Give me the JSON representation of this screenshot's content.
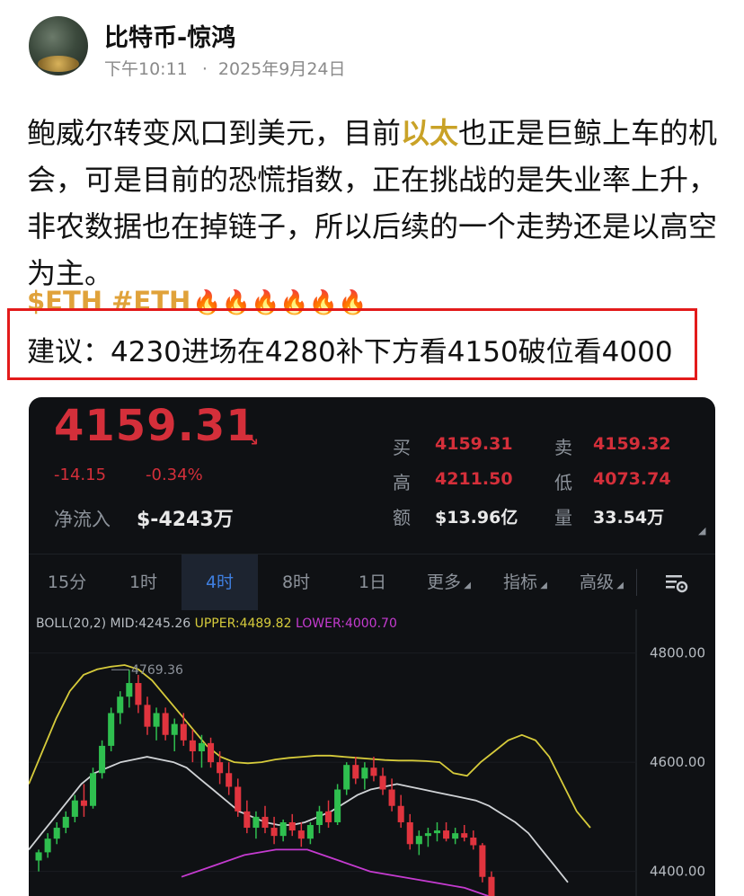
{
  "post": {
    "author": "比特币-惊鸿",
    "time": "下午10:11",
    "dot": "·",
    "date": "2025年9月24日",
    "body_before": "鲍威尔转变风口到美元，目前",
    "body_highlight": "以太",
    "body_after": "也正是巨鲸上车的机会，可是目前的恐慌指数，正在挑战的是失业率上升，非农数据也在掉链子，所以后续的一个走势还是以高空为主。",
    "tags": "$ETH #ETH",
    "fires": "🔥🔥🔥🔥🔥🔥",
    "advice": "建议：4230进场在4280补下方看4150破位看4000"
  },
  "quote": {
    "price": "4159.31",
    "arrow": "↘",
    "change": "-14.15",
    "change_pct": "-0.34%",
    "inflow_label": "净流入",
    "inflow_value": "$-4243万",
    "buy_label": "买",
    "buy": "4159.31",
    "sell_label": "卖",
    "sell": "4159.32",
    "high_label": "高",
    "high": "4211.50",
    "low_label": "低",
    "low": "4073.74",
    "amount_label": "额",
    "amount": "$13.96亿",
    "volume_label": "量",
    "volume": "33.54万"
  },
  "tabs": [
    "15分",
    "1时",
    "4时",
    "8时",
    "1日",
    "更多",
    "指标",
    "高级"
  ],
  "active_tab": "4时",
  "indicator": {
    "name": "BOLL(20,2)",
    "mid": "MID:4245.26",
    "upper": "UPPER:4489.82",
    "lower": "LOWER:4000.70"
  },
  "colors": {
    "up": "#2fbf4f",
    "down": "#e0343e",
    "upper": "#d6cb3b",
    "mid": "#d0d3d6",
    "lower": "#c53bd0",
    "accent": "#3f7fe0"
  },
  "chart_data": {
    "type": "candlestick",
    "y_ticks": [
      "4800.00",
      "4600.00",
      "4400.00"
    ],
    "ylim": [
      4355,
      4880
    ],
    "annotation": "4769.36",
    "candles": [
      [
        4420,
        4440,
        4400,
        4435
      ],
      [
        4435,
        4470,
        4425,
        4460
      ],
      [
        4460,
        4490,
        4450,
        4480
      ],
      [
        4480,
        4510,
        4470,
        4500
      ],
      [
        4500,
        4540,
        4490,
        4530
      ],
      [
        4530,
        4560,
        4500,
        4520
      ],
      [
        4520,
        4590,
        4515,
        4580
      ],
      [
        4580,
        4640,
        4570,
        4630
      ],
      [
        4630,
        4700,
        4620,
        4690
      ],
      [
        4690,
        4730,
        4670,
        4720
      ],
      [
        4720,
        4769,
        4700,
        4745
      ],
      [
        4745,
        4760,
        4690,
        4705
      ],
      [
        4705,
        4720,
        4650,
        4665
      ],
      [
        4665,
        4700,
        4640,
        4690
      ],
      [
        4690,
        4700,
        4640,
        4650
      ],
      [
        4650,
        4680,
        4620,
        4670
      ],
      [
        4670,
        4690,
        4630,
        4640
      ],
      [
        4640,
        4660,
        4600,
        4620
      ],
      [
        4620,
        4650,
        4590,
        4635
      ],
      [
        4635,
        4645,
        4590,
        4600
      ],
      [
        4600,
        4620,
        4560,
        4580
      ],
      [
        4580,
        4600,
        4540,
        4555
      ],
      [
        4555,
        4570,
        4500,
        4510
      ],
      [
        4510,
        4530,
        4470,
        4480
      ],
      [
        4480,
        4510,
        4460,
        4500
      ],
      [
        4500,
        4520,
        4470,
        4480
      ],
      [
        4480,
        4500,
        4450,
        4465
      ],
      [
        4465,
        4495,
        4455,
        4490
      ],
      [
        4490,
        4505,
        4465,
        4475
      ],
      [
        4475,
        4490,
        4445,
        4460
      ],
      [
        4460,
        4490,
        4450,
        4485
      ],
      [
        4485,
        4520,
        4470,
        4510
      ],
      [
        4510,
        4530,
        4480,
        4490
      ],
      [
        4490,
        4560,
        4485,
        4550
      ],
      [
        4550,
        4600,
        4540,
        4595
      ],
      [
        4595,
        4610,
        4560,
        4570
      ],
      [
        4570,
        4600,
        4550,
        4590
      ],
      [
        4590,
        4610,
        4565,
        4575
      ],
      [
        4575,
        4590,
        4540,
        4550
      ],
      [
        4550,
        4570,
        4510,
        4520
      ],
      [
        4520,
        4540,
        4480,
        4490
      ],
      [
        4490,
        4505,
        4440,
        4450
      ],
      [
        4450,
        4475,
        4430,
        4465
      ],
      [
        4465,
        4480,
        4445,
        4470
      ],
      [
        4470,
        4490,
        4455,
        4475
      ],
      [
        4475,
        4490,
        4455,
        4460
      ],
      [
        4460,
        4480,
        4450,
        4470
      ],
      [
        4470,
        4485,
        4455,
        4462
      ],
      [
        4462,
        4475,
        4440,
        4448
      ],
      [
        4448,
        4452,
        4380,
        4390
      ],
      [
        4390,
        4400,
        4340,
        4350
      ]
    ],
    "upper_band": [
      4560,
      4620,
      4680,
      4730,
      4760,
      4770,
      4775,
      4778,
      4770,
      4750,
      4720,
      4690,
      4660,
      4630,
      4610,
      4600,
      4598,
      4600,
      4605,
      4608,
      4610,
      4612,
      4612,
      4610,
      4608,
      4606,
      4604,
      4603,
      4603,
      4602,
      4600,
      4580,
      4575,
      4600,
      4620,
      4640,
      4650,
      4640,
      4610,
      4560,
      4510,
      4480
    ],
    "mid_band": [
      4440,
      4470,
      4500,
      4530,
      4560,
      4580,
      4590,
      4600,
      4605,
      4610,
      4605,
      4600,
      4590,
      4570,
      4550,
      4530,
      4510,
      4500,
      4490,
      4485,
      4485,
      4490,
      4500,
      4510,
      4525,
      4540,
      4550,
      4555,
      4560,
      4555,
      4550,
      4545,
      4540,
      4535,
      4530,
      4520,
      4505,
      4490,
      4470,
      4440,
      4410,
      4380
    ],
    "lower_band": [
      4390,
      4410,
      4430,
      4440,
      4440,
      4420,
      4400,
      4390,
      4380,
      4370,
      4350
    ]
  }
}
